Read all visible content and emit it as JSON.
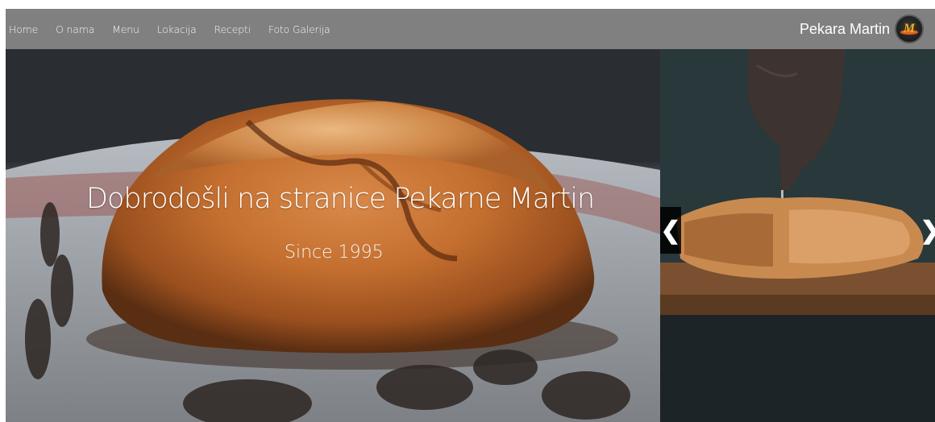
{
  "nav": {
    "links": [
      "Home",
      "O nama",
      "Menu",
      "Lokacija",
      "Recepti",
      "Foto Galerija"
    ],
    "brand_name": "Pekara Martin",
    "logo_letter": "M"
  },
  "hero": {
    "title": "Dobrodošli na stranice Pekarne Martin",
    "subtitle": "Since 1995"
  },
  "carousel": {
    "prev_symbol": "❮",
    "next_symbol": "❯"
  },
  "colors": {
    "navbar_bg": "#808080",
    "nav_text": "#f4f4f4",
    "logo_accent": "#f0b020"
  }
}
